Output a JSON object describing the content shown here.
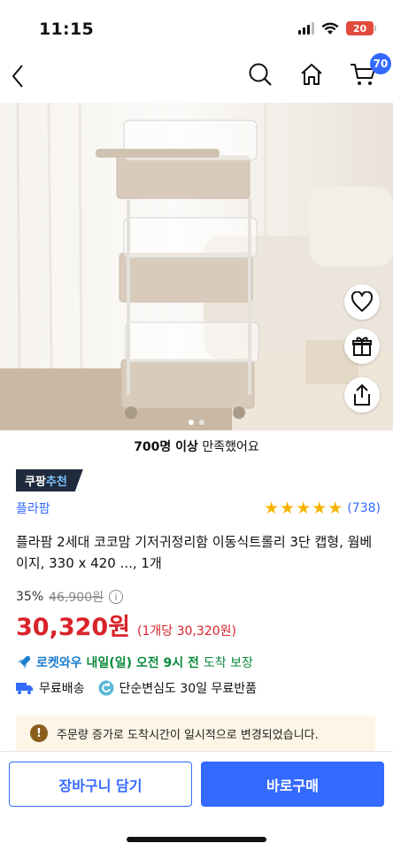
{
  "status_bar": {
    "time": "11:15",
    "battery": "20",
    "icons": [
      "signal-icon",
      "wifi-icon",
      "battery-icon"
    ]
  },
  "nav": {
    "back_icon": "chevron-left-icon",
    "search_icon": "search-icon",
    "home_icon": "home-icon",
    "cart_icon": "cart-icon",
    "cart_count": "70"
  },
  "image_actions": {
    "icons": [
      "heart-icon",
      "gift-icon",
      "share-icon"
    ],
    "pagination": {
      "count": 2,
      "active": 1
    }
  },
  "satisfaction": {
    "count": "700명 이상",
    "suffix": " 만족했어요"
  },
  "badge": {
    "part1": "쿠팡",
    "part2": "추천"
  },
  "brand": "플라팜",
  "rating": {
    "stars": 5,
    "count": "(738)"
  },
  "title": "플라팜 2세대 코코맘 기저귀정리함 이동식트롤리 3단 캡형, 웜베이지, 330 x 420 ..., 1개",
  "pricing": {
    "discount": "35%",
    "original": "46,900원",
    "price": "30,320원",
    "unit": "(1개당 30,320원)"
  },
  "delivery": {
    "rocket": "로켓와우",
    "date": "내일(일) 오전 9시 전",
    "suffix": "도착 보장"
  },
  "shipping": {
    "free_shipping": "무료배송",
    "free_return": "단순변심도 30일 무료반품"
  },
  "notice": {
    "text": "주문량 증가로 도착시간이 일시적으로 변경되었습니다."
  },
  "actions": {
    "cart": "장바구니 담기",
    "buy": "바로구매"
  },
  "colors": {
    "accent": "#346aff",
    "price": "#d8232a",
    "delivery": "#0a8a3b",
    "star": "#f7b300"
  }
}
